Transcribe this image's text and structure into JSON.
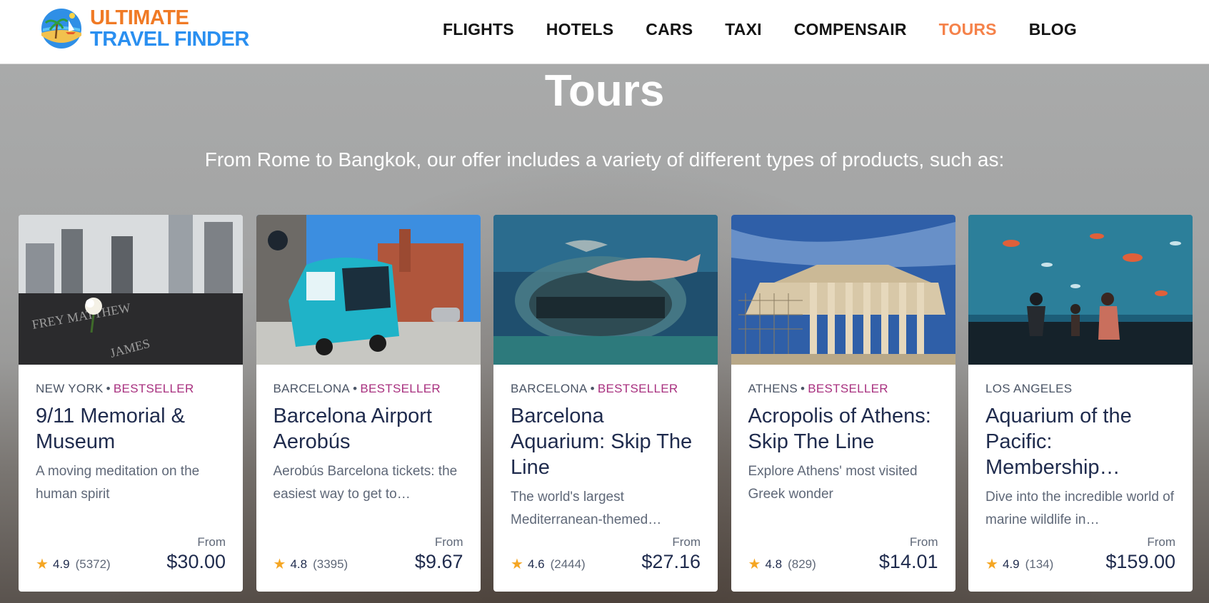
{
  "brand": {
    "line1": "ULTIMATE",
    "line2": "TRAVEL FINDER"
  },
  "nav": [
    {
      "label": "FLIGHTS",
      "active": false
    },
    {
      "label": "HOTELS",
      "active": false
    },
    {
      "label": "CARS",
      "active": false
    },
    {
      "label": "TAXI",
      "active": false
    },
    {
      "label": "COMPENSAIR",
      "active": false
    },
    {
      "label": "TOURS",
      "active": true
    },
    {
      "label": "BLOG",
      "active": false
    }
  ],
  "hero": {
    "title": "Tours",
    "subtitle": "From Rome to Bangkok, our offer includes a variety of different types of products, such as:"
  },
  "cards": [
    {
      "city": "NEW YORK",
      "badge": "BESTSELLER",
      "title": "9/11 Memorial & Museum",
      "desc": "A moving meditation on the human spirit",
      "rating": "4.9",
      "reviews": "(5372)",
      "from": "From",
      "price": "$30.00",
      "image": "memorial-rose-photo"
    },
    {
      "city": "BARCELONA",
      "badge": "BESTSELLER",
      "title": "Barcelona Airport Aerobús",
      "desc": "Aerobús Barcelona tickets: the easiest way to get to…",
      "rating": "4.8",
      "reviews": "(3395)",
      "from": "From",
      "price": "$9.67",
      "image": "aerobus-photo"
    },
    {
      "city": "BARCELONA",
      "badge": "BESTSELLER",
      "title": "Barcelona Aquarium: Skip The Line",
      "desc": "The world's largest Mediterranean-themed…",
      "rating": "4.6",
      "reviews": "(2444)",
      "from": "From",
      "price": "$27.16",
      "image": "shark-tunnel-photo"
    },
    {
      "city": "ATHENS",
      "badge": "BESTSELLER",
      "title": "Acropolis of Athens: Skip The Line",
      "desc": "Explore Athens' most visited Greek wonder",
      "rating": "4.8",
      "reviews": "(829)",
      "from": "From",
      "price": "$14.01",
      "image": "parthenon-photo"
    },
    {
      "city": "LOS ANGELES",
      "badge": "",
      "title": "Aquarium of the Pacific: Membership…",
      "desc": "Dive into the incredible world of marine wildlife in…",
      "rating": "4.9",
      "reviews": "(134)",
      "from": "From",
      "price": "$159.00",
      "image": "aquarium-window-photo"
    }
  ],
  "colors": {
    "accent": "#f5824a",
    "brand_orange": "#f07a25",
    "brand_blue": "#2a8ff0",
    "badge": "#a8307f",
    "star": "#f5a623"
  }
}
